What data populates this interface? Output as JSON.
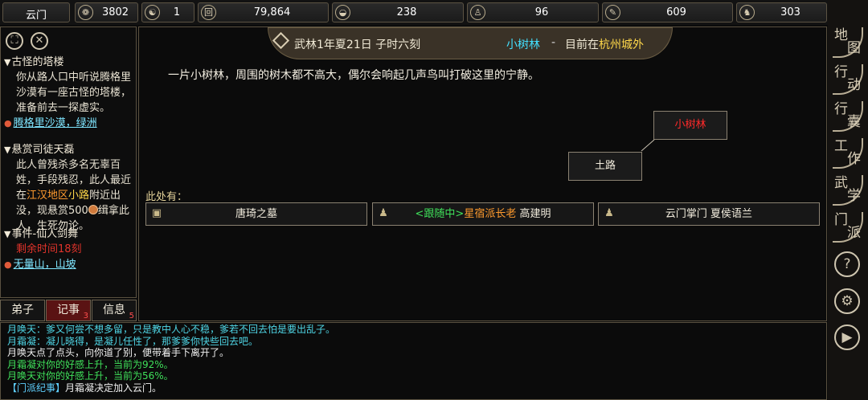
{
  "topbar": {
    "sect": "云门",
    "resources": [
      {
        "icon": "coin-bag-icon",
        "glyph": "❁",
        "value": "3802"
      },
      {
        "icon": "yin-yang-icon",
        "glyph": "☯",
        "value": "1"
      },
      {
        "icon": "copper-coin-icon",
        "glyph": "回",
        "value": "79,864"
      },
      {
        "icon": "food-bowl-icon",
        "glyph": "◒",
        "value": "238"
      },
      {
        "icon": "meditation-icon",
        "glyph": "♙",
        "value": "96"
      },
      {
        "icon": "scroll-icon",
        "glyph": "✎",
        "value": "609"
      },
      {
        "icon": "horse-icon",
        "glyph": "♞",
        "value": "303"
      }
    ]
  },
  "left": {
    "quests": [
      {
        "title": "古怪的塔楼",
        "body": "你从路人口中听说腾格里沙漠有一座古怪的塔楼，准备前去一探虚实。",
        "location": "腾格里沙漠，绿洲"
      },
      {
        "title": "悬赏司徒天磊",
        "body_a": "此人曾残杀多名无辜百姓，手段残忍，此人最近在",
        "region": "江汉地区",
        "road": "小路",
        "body_b": "附近出没，现悬赏500",
        "body_c": "缉拿此人，生死勿论。"
      },
      {
        "title": "事件-仙人剑舞",
        "remaining": "剩余时间18刻",
        "location": "无量山，山坡"
      }
    ],
    "tabs": [
      {
        "label": "弟子",
        "badge": ""
      },
      {
        "label": "记事",
        "badge": "3"
      },
      {
        "label": "信息",
        "badge": "5"
      }
    ]
  },
  "main": {
    "date": "武林1年夏21日 子时六刻",
    "place": "小树林",
    "sep": "-",
    "currently_at": "目前在",
    "city": "杭州城外",
    "description": "一片小树林，周围的树木都不高大，偶尔会响起几声鸟叫打破这里的宁静。",
    "map_nodes": {
      "current": "小树林",
      "neighbor": "土路"
    },
    "here_label": "此处有：",
    "entities": [
      {
        "icon": "box-icon",
        "text": "唐琦之墓"
      },
      {
        "icon": "person-icon",
        "follow": "<跟随中>",
        "title": "星宿派长老",
        "name": "高建明"
      },
      {
        "icon": "person-icon",
        "text": "云门掌门 夏侯语兰"
      }
    ]
  },
  "log": [
    {
      "kind": "cyan",
      "text": "月唤天：爹又何尝不想多留，只是教中人心不稳，爹若不回去怕是要出乱子。"
    },
    {
      "kind": "cyan",
      "text": "月霜凝：凝儿晓得，是凝儿任性了，那爹爹你快些回去吧。"
    },
    {
      "kind": "white",
      "text": "月唤天点了点头，向你道了别，便带着手下离开了。"
    },
    {
      "kind": "green",
      "text": "月霜凝对你的好感上升，当前为92%。"
    },
    {
      "kind": "green",
      "text": "月唤天对你的好感上升，当前为56%。"
    },
    {
      "kind": "tag",
      "tag": "【门派纪事】",
      "text": "月霜凝决定加入云门。"
    }
  ],
  "rightnav": [
    {
      "name": "map",
      "c1": "地",
      "c2": "图"
    },
    {
      "name": "action",
      "c1": "行",
      "c2": "动"
    },
    {
      "name": "bag",
      "c1": "行",
      "c2": "囊"
    },
    {
      "name": "work",
      "c1": "工",
      "c2": "作"
    },
    {
      "name": "martial",
      "c1": "武",
      "c2": "学"
    },
    {
      "name": "sect",
      "c1": "门",
      "c2": "派"
    }
  ],
  "rightbuttons": {
    "help": "?",
    "settings": "⚙",
    "play": "▶"
  }
}
